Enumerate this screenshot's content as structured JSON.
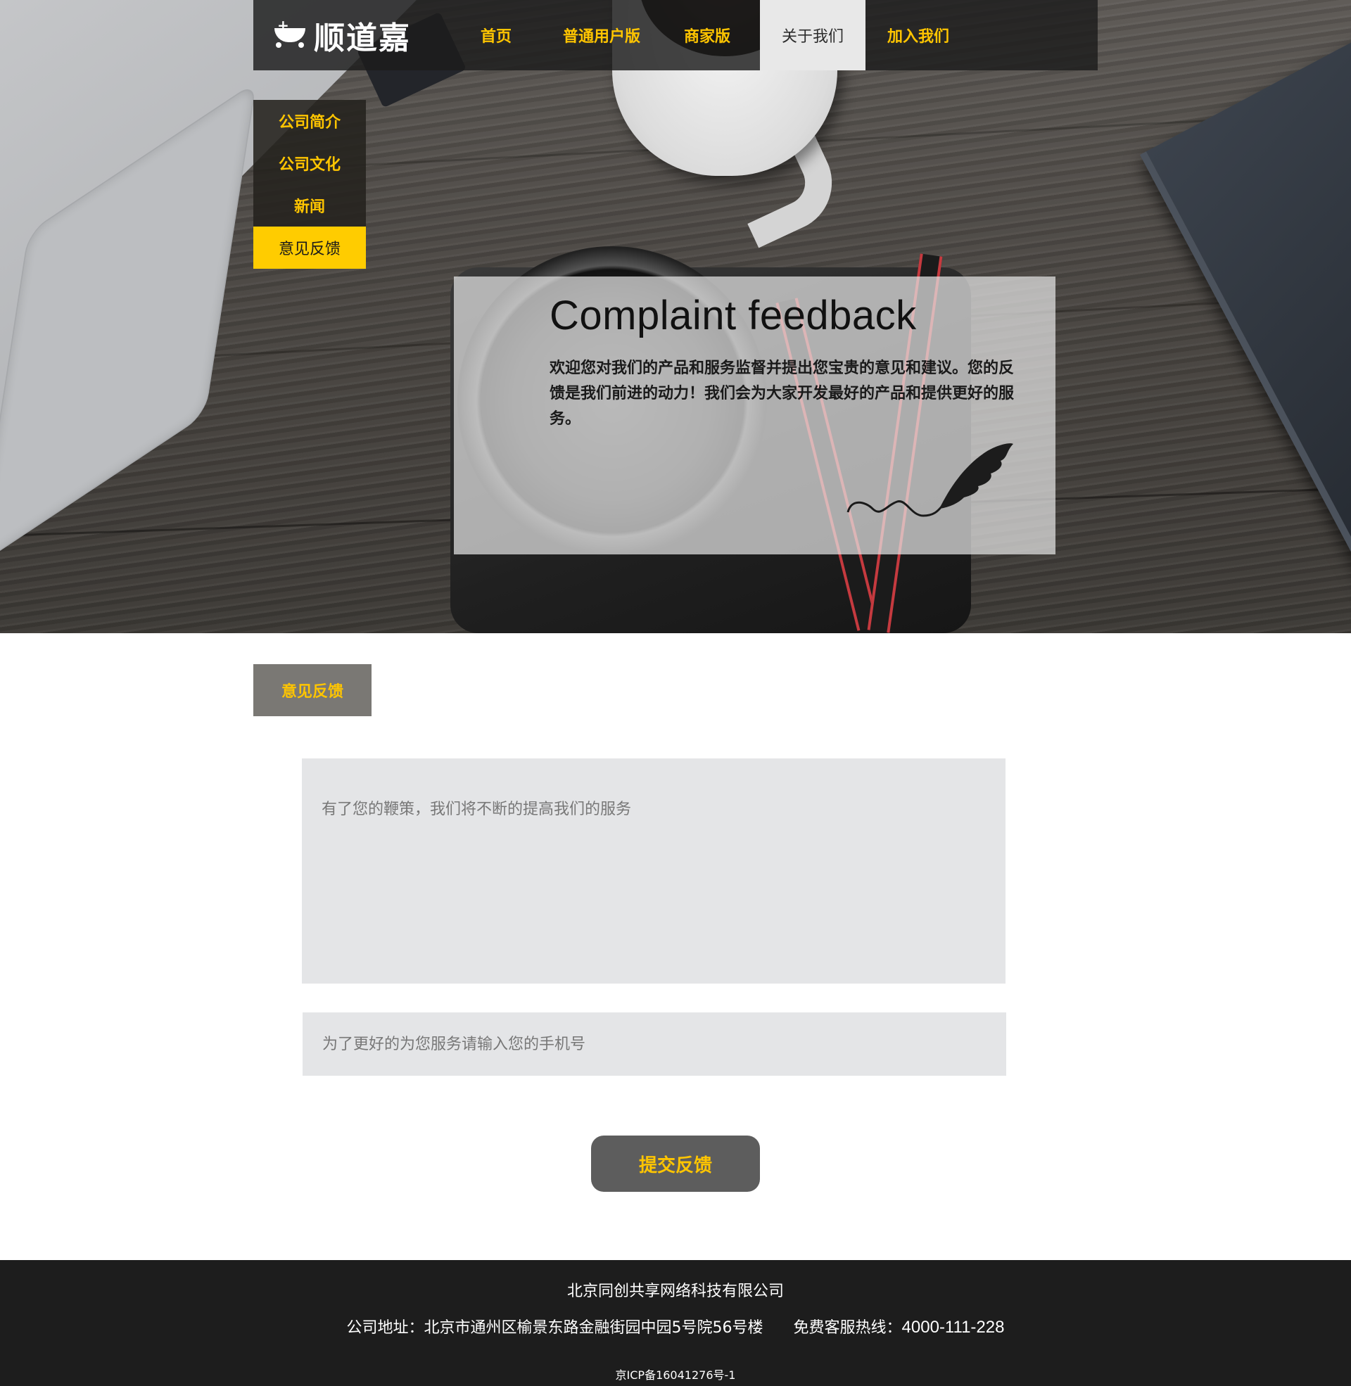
{
  "brand": {
    "logo_text": "顺道嘉",
    "logo_plus": "+"
  },
  "nav": {
    "items": [
      {
        "label": "首页"
      },
      {
        "label": "普通用户版"
      },
      {
        "label": "商家版"
      },
      {
        "label": "关于我们"
      },
      {
        "label": "加入我们"
      }
    ],
    "active": "关于我们"
  },
  "submenu": {
    "items": [
      {
        "label": "公司简介"
      },
      {
        "label": "公司文化"
      },
      {
        "label": "新闻"
      },
      {
        "label": "意见反馈"
      }
    ],
    "active": "意见反馈"
  },
  "hero": {
    "title": "Complaint feedback",
    "description": "欢迎您对我们的产品和服务监督并提出您宝贵的意见和建议。您的反馈是我们前进的动力！我们会为大家开发最好的产品和提供更好的服务。"
  },
  "section_tab": {
    "label": "意见反馈"
  },
  "form": {
    "feedback_placeholder": "有了您的鞭策，我们将不断的提高我们的服务",
    "phone_placeholder": "为了更好的为您服务请输入您的手机号",
    "submit_label": "提交反馈"
  },
  "footer": {
    "company": "北京同创共享网络科技有限公司",
    "address_label": "公司地址：北京市通州区榆景东路金融街园中园5号院56号楼",
    "hotline_label": "免费客服热线：",
    "hotline_number": "4000-111-228",
    "icp": "京ICP备16041276号-1"
  },
  "colors": {
    "accent": "#ffc500",
    "nav_bg": "#1c1c1c",
    "active_submenu": "#ffcc00",
    "input_bg": "#e4e5e7",
    "button_bg": "#5d5d5d",
    "footer_bg": "#1d1d1d"
  },
  "icons": [
    "quill-pen-icon",
    "logo-mark-icon"
  ]
}
